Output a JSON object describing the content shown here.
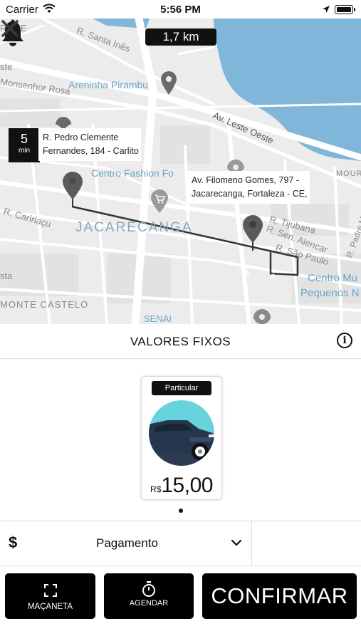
{
  "status_bar": {
    "carrier": "Carrier",
    "time": "5:56 PM"
  },
  "map": {
    "distance": "1,7 km",
    "eta": {
      "value": "5",
      "unit": "min"
    },
    "origin_address": [
      "R. Pedro Clemente",
      "Fernandes, 184 - Carlito"
    ],
    "destination_address": [
      "Av. Filomeno Gomes, 797 -",
      "Jacarecanga, Fortaleza - CE,"
    ],
    "labels": {
      "street_santa_ines": "R. Santa Inês",
      "street_monsenhor": "Monsenhor Rosa",
      "place_areninha": "Areninha Pirambu",
      "street_leste_oeste": "Av. Leste Oeste",
      "place_centro_fashion": "Centro Fashion Fo",
      "street_cariri": "R. Caririaçu",
      "district_jacarecanga": "JACARECANGA",
      "street_tijubana": "R. Tijubana",
      "street_sen_alencar": "R. Sen. Alencar",
      "street_sao_paulo": "R. São Paulo",
      "place_centro_mu": "Centro Mu",
      "place_pequenos": "Pequenos N",
      "district_monte_castelo": "MONTE CASTELO",
      "place_senai": "SENAI",
      "street_padre": "R. Padre M",
      "edge_rame": "RAME",
      "edge_ste": "ste",
      "edge_sta": "sta",
      "edge_mour": "MOUR"
    }
  },
  "section": {
    "title": "VALORES FIXOS"
  },
  "vehicle": {
    "category": "Particular",
    "currency": "R$",
    "price": "15,00"
  },
  "payment": {
    "icon": "$",
    "label": "Pagamento"
  },
  "buttons": {
    "macaneta": "MAÇANETA",
    "agendar": "AGENDAR",
    "confirmar": "CONFIRMAR"
  },
  "colors": {
    "water": "#7fb6d9",
    "map_bg": "#ececec",
    "road": "#ffffff",
    "route": "#333333",
    "pin": "#555555",
    "button_bg": "#000000"
  }
}
